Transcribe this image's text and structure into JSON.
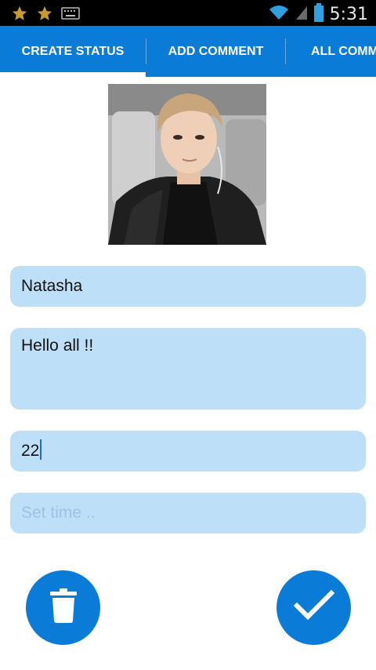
{
  "status_bar": {
    "time": "5:31",
    "icons": [
      "star-icon",
      "star-icon",
      "keyboard-icon",
      "wifi-icon",
      "signal-icon",
      "battery-icon"
    ]
  },
  "tabs": [
    {
      "label": "CREATE STATUS",
      "selected": true
    },
    {
      "label": "ADD COMMENT",
      "selected": false
    },
    {
      "label": "ALL COMMENTS",
      "selected": false
    }
  ],
  "form": {
    "name_value": "Natasha",
    "status_value": "Hello all !!",
    "age_value": "22",
    "time_placeholder": "Set time .."
  },
  "actions": {
    "delete_icon": "trash-icon",
    "confirm_icon": "checkmark-icon"
  },
  "colors": {
    "primary": "#0a7bd6",
    "field_background": "#bde0f8",
    "placeholder": "#9ec3e6",
    "status_bar": "#000000"
  }
}
